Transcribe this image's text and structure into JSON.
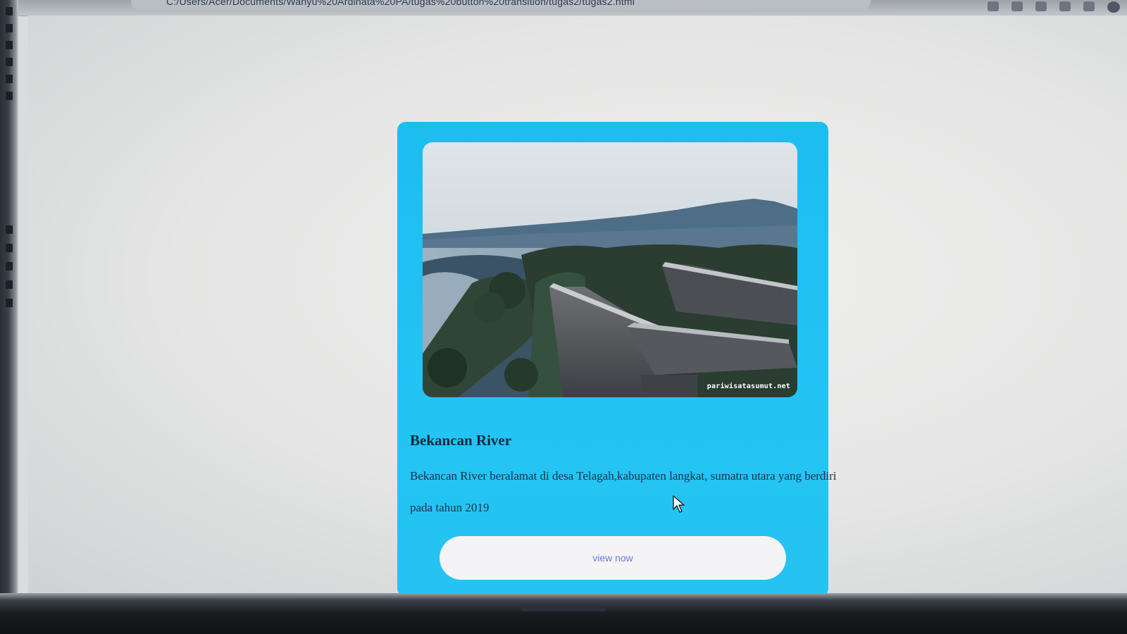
{
  "browser": {
    "address": "C:/Users/Acer/Documents/Wahyu%20Ardinata%20PA/tugas%20button%20transition/tugas2/tugas2.html"
  },
  "card": {
    "image_watermark": "pariwisatasumut.net",
    "title": "Bekancan River",
    "description": "Bekancan River beralamat di desa Telagah,kabupaten langkat, sumatra utara yang berdiri pada tahun 2019",
    "button_label": "view now"
  },
  "colors": {
    "card_background": "#23c4f4",
    "button_text": "#6b78d6",
    "page_background": "#e6e7e6"
  }
}
